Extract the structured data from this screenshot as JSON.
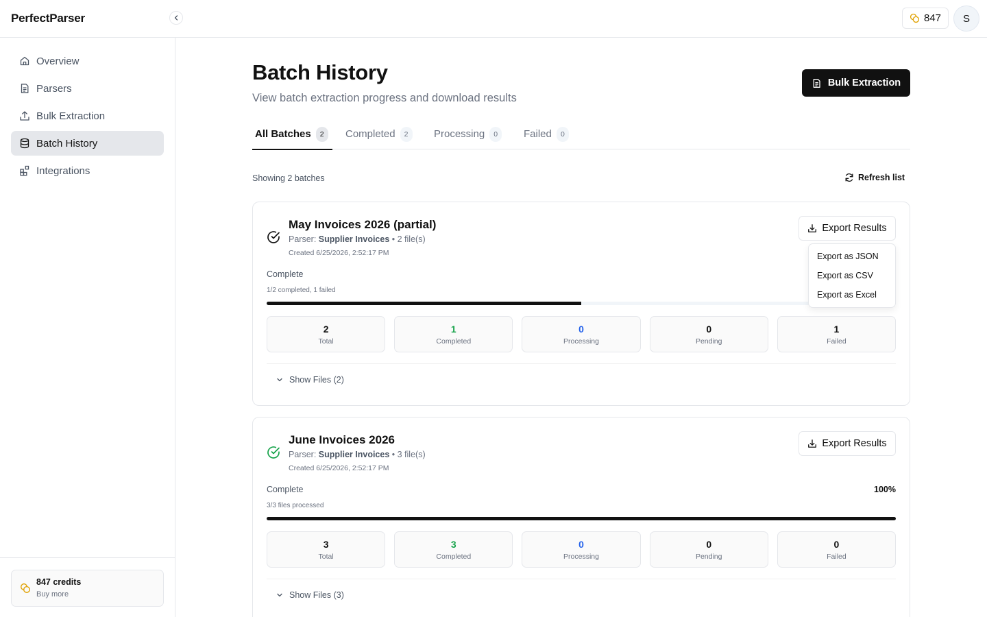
{
  "app": {
    "brand": "PerfectParser",
    "credits": "847",
    "avatar_initial": "S"
  },
  "sidebar": {
    "items": [
      {
        "label": "Overview",
        "icon": "home-icon",
        "active": false
      },
      {
        "label": "Parsers",
        "icon": "file-text-icon",
        "active": false
      },
      {
        "label": "Bulk Extraction",
        "icon": "upload-icon",
        "active": false
      },
      {
        "label": "Batch History",
        "icon": "database-icon",
        "active": true
      },
      {
        "label": "Integrations",
        "icon": "puzzle-icon",
        "active": false
      }
    ],
    "credits_card": {
      "title": "847 credits",
      "subtitle": "Buy more"
    }
  },
  "page": {
    "title": "Batch History",
    "subtitle": "View batch extraction progress and download results",
    "bulk_button": "Bulk Extraction"
  },
  "tabs": [
    {
      "label": "All Batches",
      "count": "2",
      "active": true
    },
    {
      "label": "Completed",
      "count": "2",
      "active": false
    },
    {
      "label": "Processing",
      "count": "0",
      "active": false
    },
    {
      "label": "Failed",
      "count": "0",
      "active": false
    }
  ],
  "list": {
    "showing": "Showing 2 batches",
    "refresh": "Refresh list"
  },
  "batches": [
    {
      "title": "May Invoices 2026 (partial)",
      "parser_prefix": "Parser:",
      "parser_name": "Supplier Invoices",
      "files": "• 2 file(s)",
      "created": "Created 6/25/2026, 2:52:17 PM",
      "export_label": "Export Results",
      "progress_label": "Complete",
      "progress_pct": "",
      "progress_sub": "1/2 completed, 1 failed",
      "progress_fraction": 0.5,
      "status_color": "#111111",
      "stats": [
        {
          "value": "2",
          "label": "Total"
        },
        {
          "value": "1",
          "label": "Completed"
        },
        {
          "value": "0",
          "label": "Processing"
        },
        {
          "value": "0",
          "label": "Pending"
        },
        {
          "value": "1",
          "label": "Failed"
        }
      ],
      "show_files": "Show Files (2)"
    },
    {
      "title": "June Invoices 2026",
      "parser_prefix": "Parser:",
      "parser_name": "Supplier Invoices",
      "files": "• 3 file(s)",
      "created": "Created 6/25/2026, 2:52:17 PM",
      "export_label": "Export Results",
      "progress_label": "Complete",
      "progress_pct": "100%",
      "progress_sub": "3/3 files processed",
      "progress_fraction": 1.0,
      "status_color": "#16a34a",
      "stats": [
        {
          "value": "3",
          "label": "Total"
        },
        {
          "value": "3",
          "label": "Completed"
        },
        {
          "value": "0",
          "label": "Processing"
        },
        {
          "value": "0",
          "label": "Pending"
        },
        {
          "value": "0",
          "label": "Failed"
        }
      ],
      "show_files": "Show Files (3)"
    }
  ],
  "export_menu": {
    "items": [
      "Export as JSON",
      "Export as CSV",
      "Export as Excel"
    ]
  },
  "colors": {
    "accent": "#111111",
    "success": "#16a34a",
    "info": "#2563eb",
    "coin": "#e0a100"
  }
}
